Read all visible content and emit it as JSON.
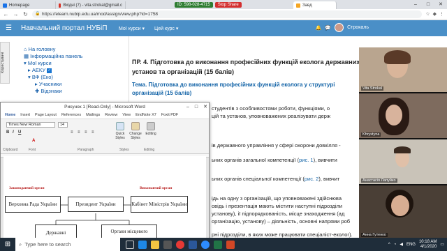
{
  "browser": {
    "tabs": [
      {
        "label": "Homepage",
        "color": "#1a73e8"
      },
      {
        "label": "Вхідні (7) - vita.strokal@gmail.c",
        "color": "#d93025"
      },
      {
        "label": "Завд",
        "color": "#f5a623"
      }
    ],
    "id_badge": "ID: 598-028-4715",
    "stop_share": "Stop Share",
    "url": "https://elearn.nubip.edu.ua/mod/assign/view.php?id=1758"
  },
  "header": {
    "site_title": "Навчальний портал НУБіП",
    "menu": [
      "Мої курси",
      "Цей курс"
    ],
    "user": "Строкаль"
  },
  "sidebar": {
    "tab_label": "Користувачі",
    "items": [
      {
        "label": "На головну"
      },
      {
        "label": "Інформаційна панель"
      },
      {
        "label": "Мої курси"
      },
      {
        "label": "АЕКУ"
      },
      {
        "label": "ВФ (Еко)"
      },
      {
        "label": "Учасники"
      },
      {
        "label": "Відзнаки"
      }
    ]
  },
  "main": {
    "title": "ПР. 4. Підготовка до виконання професійних функцій еколога державних установ та організацій (15 балів)",
    "topic": "Тема. Підготовка до виконання професійних функцій еколога у структурі організацій (15 балів)",
    "lines": [
      "студентів з особливостями роботи, функціями, о",
      "цій та установ, уповноважених реалізувати держ",
      "ів державного управління у сфері охорони довкілля -",
      "ьних органів загальної компетенції (",
      "рис. 1",
      "), вивчити",
      "ьних органів спеціальної компетенції (",
      "рис. 2",
      "), вивчит",
      "ідь на одну з організацій, що уповноважені здійснюва",
      "овідь і презентація мають містити наступні підрозділи",
      "установу), ії підпорядкованість, місце знаходження (ад",
      "організацію, установу) – діяльність, основні напрями роб",
      "рні підрозділи, в яких може працювати спеціаліст-еколог)."
    ]
  },
  "word": {
    "title": "Рисунок 1 [Read-Only] - Microsoft Word",
    "tabs": [
      "Home",
      "Insert",
      "Page Layout",
      "References",
      "Mailings",
      "Review",
      "View",
      "EndNote X7",
      "Foxit PDF"
    ],
    "font": "Times New Roman",
    "size": "14",
    "groups": [
      "Clipboard",
      "Font",
      "Paragraph",
      "Styles",
      "Editing"
    ],
    "quick_styles": "Quick Styles",
    "change_styles": "Change Styles",
    "editing": "Editing",
    "diagram": {
      "label_left": "Законодавчий орган",
      "label_right": "Виконавчий орган",
      "box_verkhovna": "Верховна Рада України",
      "box_president": "Президент України",
      "box_cabinet": "Кабінет Міністрів України",
      "box_state": "Державні",
      "box_local": "Органи місцевого"
    }
  },
  "videos": [
    {
      "name": "Vita Strokal"
    },
    {
      "name": "Khrystyna"
    },
    {
      "name": "Анастасія Лапуйко"
    },
    {
      "name": "Анна Гутенко"
    }
  ],
  "taskbar": {
    "search_placeholder": "Type here to search",
    "time": "10:18 AM",
    "date": "4/1/2020",
    "lang": "ENG"
  }
}
